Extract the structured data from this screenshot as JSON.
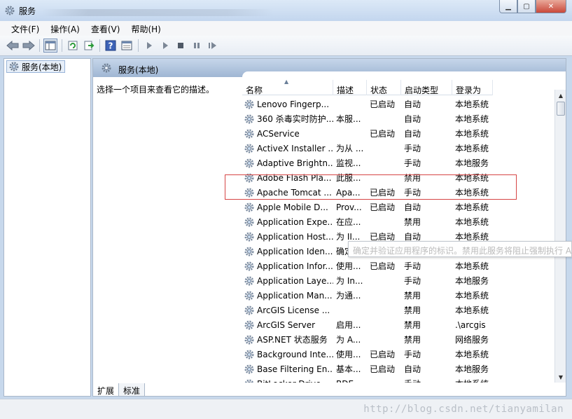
{
  "window": {
    "title": "服务",
    "controls": [
      "minimize",
      "maximize",
      "close"
    ]
  },
  "menu": [
    "文件(F)",
    "操作(A)",
    "查看(V)",
    "帮助(H)"
  ],
  "toolbar_icons": [
    "back-icon",
    "forward-icon",
    "console-tree-icon",
    "refresh-icon",
    "export-icon",
    "help-icon",
    "properties-icon",
    "start-icon",
    "start-alt-icon",
    "stop-icon",
    "pause-icon",
    "restart-icon"
  ],
  "tree": {
    "item": "服务(本地)"
  },
  "pane": {
    "title": "服务(本地)",
    "description": "选择一个项目来查看它的描述。"
  },
  "columns": [
    "名称",
    "描述",
    "状态",
    "启动类型",
    "登录为"
  ],
  "services": [
    {
      "name": "Lenovo Fingerp...",
      "desc": "",
      "status": "已启动",
      "startup": "自动",
      "logon": "本地系统"
    },
    {
      "name": "360 杀毒实时防护...",
      "desc": "本服...",
      "status": "",
      "startup": "自动",
      "logon": "本地系统"
    },
    {
      "name": "ACService",
      "desc": "",
      "status": "已启动",
      "startup": "自动",
      "logon": "本地系统"
    },
    {
      "name": "ActiveX Installer ...",
      "desc": "为从 ...",
      "status": "",
      "startup": "手动",
      "logon": "本地系统"
    },
    {
      "name": "Adaptive Brightn...",
      "desc": "监视...",
      "status": "",
      "startup": "手动",
      "logon": "本地服务"
    },
    {
      "name": "Adobe Flash Pla...",
      "desc": "此服...",
      "status": "",
      "startup": "禁用",
      "logon": "本地系统"
    },
    {
      "name": "Apache Tomcat ...",
      "desc": "Apa...",
      "status": "已启动",
      "startup": "手动",
      "logon": "本地系统"
    },
    {
      "name": "Apple Mobile D...",
      "desc": "Prov...",
      "status": "已启动",
      "startup": "自动",
      "logon": "本地系统"
    },
    {
      "name": "Application Expe...",
      "desc": "在应...",
      "status": "",
      "startup": "禁用",
      "logon": "本地系统"
    },
    {
      "name": "Application Host...",
      "desc": "为 II...",
      "status": "已启动",
      "startup": "自动",
      "logon": "本地系统"
    },
    {
      "name": "Application Iden...",
      "desc": "确定...",
      "status": "",
      "startup": "手动",
      "logon": "本地服务"
    },
    {
      "name": "Application Infor...",
      "desc": "使用...",
      "status": "已启动",
      "startup": "手动",
      "logon": "本地系统"
    },
    {
      "name": "Application Laye...",
      "desc": "为 In...",
      "status": "",
      "startup": "手动",
      "logon": "本地服务"
    },
    {
      "name": "Application Man...",
      "desc": "为通...",
      "status": "",
      "startup": "禁用",
      "logon": "本地系统"
    },
    {
      "name": "ArcGIS License ...",
      "desc": "",
      "status": "",
      "startup": "禁用",
      "logon": "本地系统"
    },
    {
      "name": "ArcGIS Server",
      "desc": "启用...",
      "status": "",
      "startup": "禁用",
      "logon": ".\\arcgis"
    },
    {
      "name": "ASP.NET 状态服务",
      "desc": "为 A...",
      "status": "",
      "startup": "禁用",
      "logon": "网络服务"
    },
    {
      "name": "Background Inte...",
      "desc": "使用...",
      "status": "已启动",
      "startup": "手动",
      "logon": "本地系统"
    },
    {
      "name": "Base Filtering En...",
      "desc": "基本...",
      "status": "已启动",
      "startup": "自动",
      "logon": "本地服务"
    },
    {
      "name": "BitLocker Drive ...",
      "desc": "BDE...",
      "status": "",
      "startup": "手动",
      "logon": "本地系统"
    }
  ],
  "tooltip": "确定并验证应用程序的标识。禁用此服务将阻止强制执行 AppLocker",
  "tabs": [
    "扩展",
    "标准"
  ],
  "watermark": "http://blog.csdn.net/tianyamilan"
}
